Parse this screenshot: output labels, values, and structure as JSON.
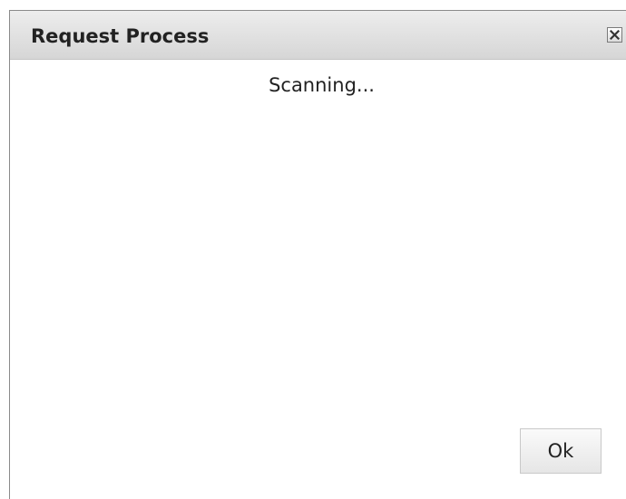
{
  "dialog": {
    "title": "Request Process",
    "close_icon": "close-icon",
    "status_text": "Scanning...",
    "ok_label": "Ok"
  },
  "colors": {
    "titlebar_top": "#ededed",
    "titlebar_bottom": "#d6d6d6",
    "text": "#222222",
    "border": "#8a8a8a"
  }
}
